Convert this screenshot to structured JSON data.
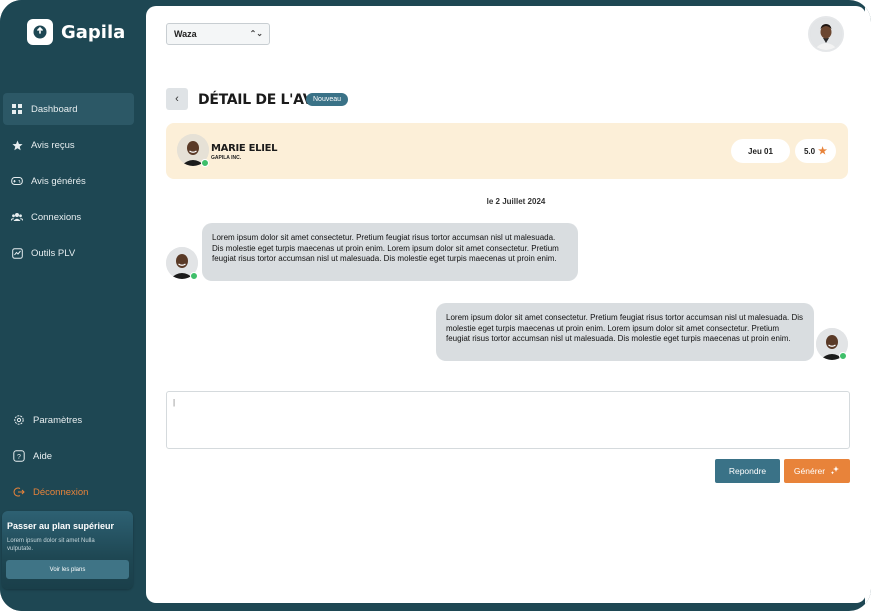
{
  "app": {
    "name": "Gapila"
  },
  "sidebar": {
    "items": [
      {
        "label": "Dashboard",
        "icon": "dashboard-icon",
        "active": true
      },
      {
        "label": "Avis reçus",
        "icon": "star-icon"
      },
      {
        "label": "Avis générés",
        "icon": "gamepad-icon"
      },
      {
        "label": "Connexions",
        "icon": "users-icon"
      },
      {
        "label": "Outils PLV",
        "icon": "tools-icon"
      }
    ],
    "bottom": {
      "settings": "Paramètres",
      "help": "Aide",
      "logout": "Déconnexion"
    },
    "upgrade": {
      "title": "Passer au plan supérieur",
      "description": "Lorem ipsum dolor sit amet Nulla vulputate.",
      "button": "Voir les plans"
    }
  },
  "header": {
    "selected_business": "Waza"
  },
  "review": {
    "title": "DÉTAIL DE L'AVIS",
    "badge": "Nouveau",
    "reviewer": {
      "name": "MARIE ELIEL",
      "company": "GAPILA INC."
    },
    "date_pill": "Jeu 01",
    "rating": "5.0",
    "date_separator": "le 2 Juillet 2024",
    "messages": [
      {
        "side": "left",
        "text": "Lorem ipsum dolor sit amet consectetur. Pretium feugiat risus tortor accumsan nisl ut malesuada. Dis molestie eget turpis maecenas ut proin enim. Lorem ipsum dolor sit amet consectetur. Pretium feugiat risus tortor accumsan nisl ut malesuada. Dis molestie eget turpis maecenas ut proin enim."
      },
      {
        "side": "right",
        "text": "Lorem ipsum dolor sit amet consectetur. Pretium feugiat risus tortor accumsan nisl ut malesuada. Dis molestie eget turpis maecenas ut proin enim. Lorem ipsum dolor sit amet consectetur. Pretium feugiat risus tortor accumsan nisl ut malesuada. Dis molestie eget turpis maecenas ut proin enim."
      }
    ],
    "composer_value": "|"
  },
  "actions": {
    "reply": "Repondre",
    "generate": "Générer"
  },
  "colors": {
    "sidebar": "#1e4753",
    "accent": "#3a7287",
    "orange": "#e8833a",
    "card": "#fcefd8",
    "bubble": "#d9dde0"
  }
}
